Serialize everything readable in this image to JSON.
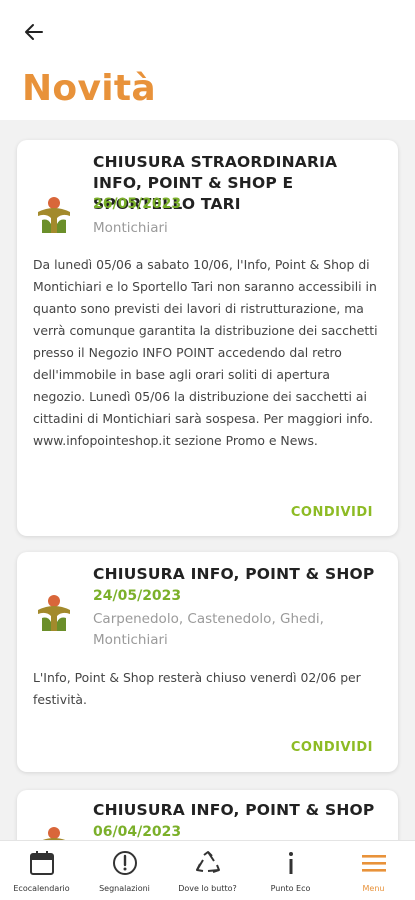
{
  "header": {
    "title": "Novità"
  },
  "colors": {
    "accent": "#e8923a",
    "date_green": "#7bb02a",
    "share_green": "#8dbb24"
  },
  "news": [
    {
      "title": "CHIUSURA STRAORDINARIA INFO, POINT & SHOP E SPORTELLO TARI",
      "date": "26/05/2023",
      "location": "Montichiari",
      "body": "Da lunedì 05/06 a sabato 10/06, l'Info, Point & Shop di Montichiari e lo Sportello Tari non saranno accessibili in quanto sono previsti dei lavori di ristrutturazione, ma verrà comunque garantita la distribuzione dei sacchetti presso il Negozio INFO POINT accedendo dal retro dell'immobile in base agli orari soliti di apertura negozio. Lunedì 05/06 la distribuzione dei sacchetti ai cittadini di Montichiari sarà sospesa. Per maggiori info. www.infopointeshop.it sezione Promo e News.",
      "share_label": "CONDIVIDI"
    },
    {
      "title": "CHIUSURA INFO, POINT & SHOP",
      "date": "24/05/2023",
      "location": "Carpenedolo, Castenedolo, Ghedi, Montichiari",
      "body": "L'Info, Point & Shop resterà chiuso venerdì 02/06 per festività.",
      "share_label": "CONDIVIDI"
    },
    {
      "title": "CHIUSURA INFO, POINT & SHOP",
      "date": "06/04/2023"
    }
  ],
  "bottom_nav": [
    {
      "label": "Ecocalendario",
      "icon": "calendar-icon"
    },
    {
      "label": "Segnalazioni",
      "icon": "alert-icon"
    },
    {
      "label": "Dove lo butto?",
      "icon": "recycle-icon"
    },
    {
      "label": "Punto Eco",
      "icon": "info-icon"
    },
    {
      "label": "Menu",
      "icon": "menu-icon",
      "active": true
    }
  ]
}
